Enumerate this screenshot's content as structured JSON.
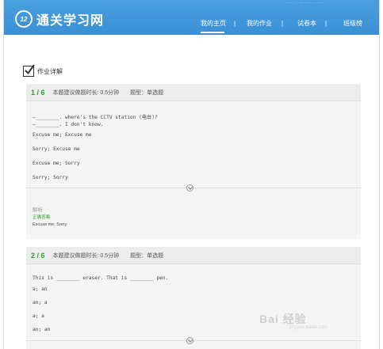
{
  "header": {
    "top_links": "· ··· · ··· · ··· · ···",
    "logo_badge": "12",
    "site_name": "通关学习网",
    "nav": [
      {
        "label": "我的主页"
      },
      {
        "label": "我的作业"
      },
      {
        "label": "试卷本"
      },
      {
        "label": "班级榜"
      }
    ],
    "nav_sep": "|"
  },
  "section": {
    "title": "作业详解"
  },
  "questions": [
    {
      "number": "1",
      "total": "/ 6",
      "suggested_time": "本题建议做题时长: 0.5分钟",
      "type": "题型：单选题",
      "lines": [
        "—________. where's the CCTV station (电台)?",
        "—________. I don't know."
      ],
      "options": [
        "Excuse me; Excuse me",
        "Sorry; Excuse me",
        "Excuse me; Sorry",
        "Sorry; Sorry"
      ],
      "analysis_label": "解析",
      "correct_label": "正确答案:",
      "correct_answer": "Excuse me; Sorry"
    },
    {
      "number": "2",
      "total": "/ 6",
      "suggested_time": "本题建议做题时长: 0.5分钟",
      "type": "题型：单选题",
      "lines": [
        "This is ________ eraser. That is ________ pen."
      ],
      "options": [
        "a; an",
        "an; a",
        "a; a",
        "an; an"
      ]
    }
  ],
  "watermark": {
    "text": "Bai  经验",
    "sub": "jingyan.baidu.com"
  },
  "colors": {
    "header_blue": "#3b8fd4",
    "green": "#2f9d2f",
    "card_bg": "#f4f4f4"
  }
}
